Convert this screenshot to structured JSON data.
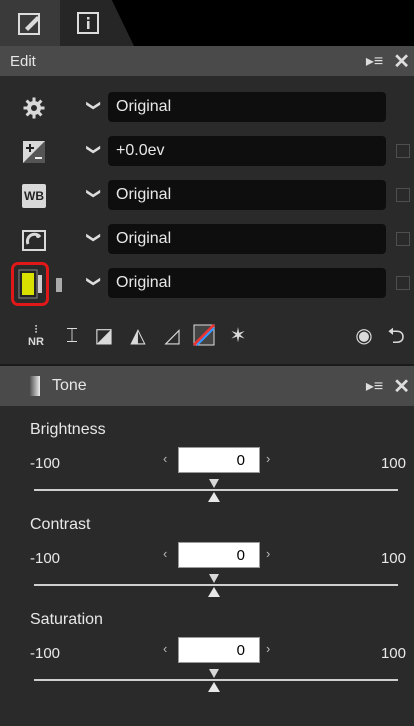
{
  "tabs": [
    {
      "icon": "edit-tab-icon"
    },
    {
      "icon": "info-tab-icon"
    }
  ],
  "edit": {
    "title": "Edit",
    "menu_glyph": "▸≡",
    "close_glyph": "✕",
    "rows": [
      {
        "icon": "gear-icon",
        "value": "Original",
        "checkbox": false
      },
      {
        "icon": "exposure-compensation-icon",
        "value": "+0.0ev",
        "checkbox": true
      },
      {
        "icon": "white-balance-icon",
        "value": "Original",
        "checkbox": true
      },
      {
        "icon": "picture-control-icon",
        "value": "Original",
        "checkbox": true
      },
      {
        "icon": "tone-icon",
        "value": "Original",
        "checkbox": true,
        "highlighted": true
      }
    ],
    "wb_text": "WB"
  },
  "tone": {
    "title": "Tone",
    "menu_glyph": "▸≡",
    "close_glyph": "✕",
    "sliders": [
      {
        "label": "Brightness",
        "min": "-100",
        "max": "100",
        "value": "0"
      },
      {
        "label": "Contrast",
        "min": "-100",
        "max": "100",
        "value": "0"
      },
      {
        "label": "Saturation",
        "min": "-100",
        "max": "100",
        "value": "0"
      }
    ]
  },
  "colors": {
    "highlight": "#e01818",
    "tone_icon_fill": "#d8e000"
  }
}
